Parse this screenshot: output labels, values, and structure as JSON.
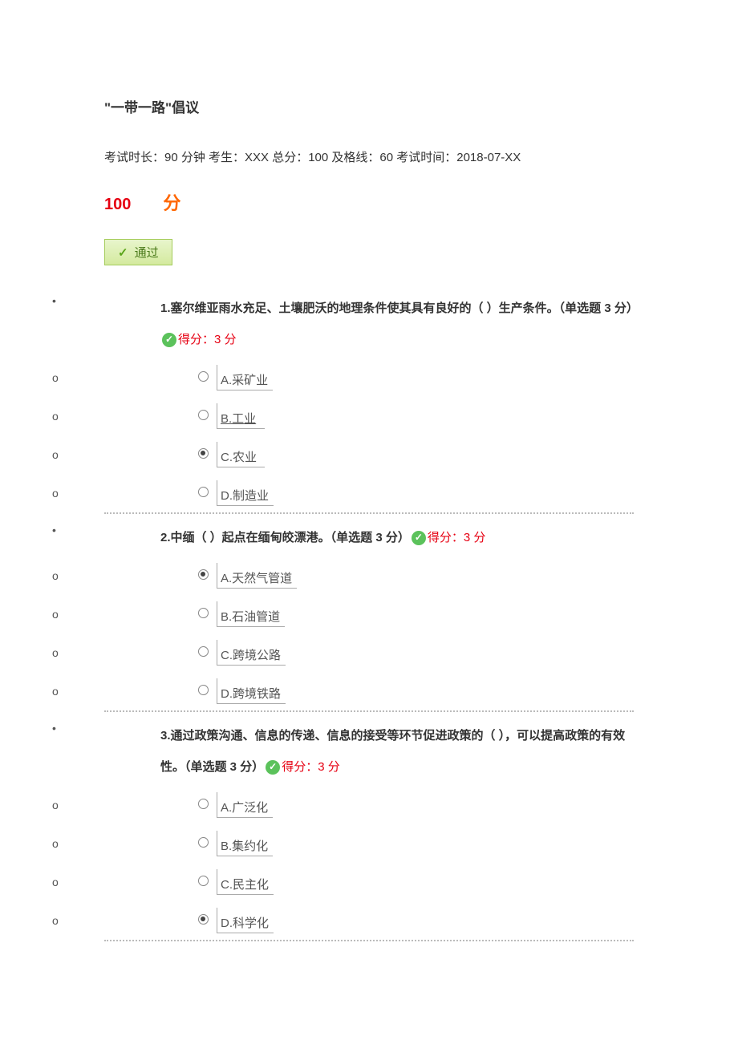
{
  "exam": {
    "title": "\"一带一路\"倡议",
    "info": "考试时长：90 分钟 考生：XXX 总分：100   及格线：60  考试时间：2018-07-XX",
    "score_number": "100",
    "score_fen": "分",
    "pass_label": "通过"
  },
  "questions": [
    {
      "text": "1.塞尔维亚雨水充足、土壤肥沃的地理条件使其具有良好的（  ）生产条件。（单选题 3 分）",
      "score_label": "得分：3 分",
      "selected_index": 2,
      "options": [
        {
          "label": "A.采矿业",
          "link": false
        },
        {
          "label": "B.工业",
          "link": true
        },
        {
          "label": "C.农业",
          "link": false
        },
        {
          "label": "D.制造业",
          "link": false
        }
      ]
    },
    {
      "text": "2.中缅（  ）起点在缅甸皎漂港。（单选题 3 分）",
      "score_label": "得分：3 分",
      "selected_index": 0,
      "options": [
        {
          "label": "A.天然气管道",
          "link": false
        },
        {
          "label": "B.石油管道",
          "link": false
        },
        {
          "label": "C.跨境公路",
          "link": false
        },
        {
          "label": "D.跨境铁路",
          "link": false
        }
      ]
    },
    {
      "text": "3.通过政策沟通、信息的传递、信息的接受等环节促进政策的（  ），可以提高政策的有效性。（单选题 3 分）",
      "score_label": "得分：3 分",
      "selected_index": 3,
      "options": [
        {
          "label": "A.广泛化",
          "link": false
        },
        {
          "label": "B.集约化",
          "link": false
        },
        {
          "label": "C.民主化",
          "link": false
        },
        {
          "label": "D.科学化",
          "link": false
        }
      ]
    }
  ]
}
